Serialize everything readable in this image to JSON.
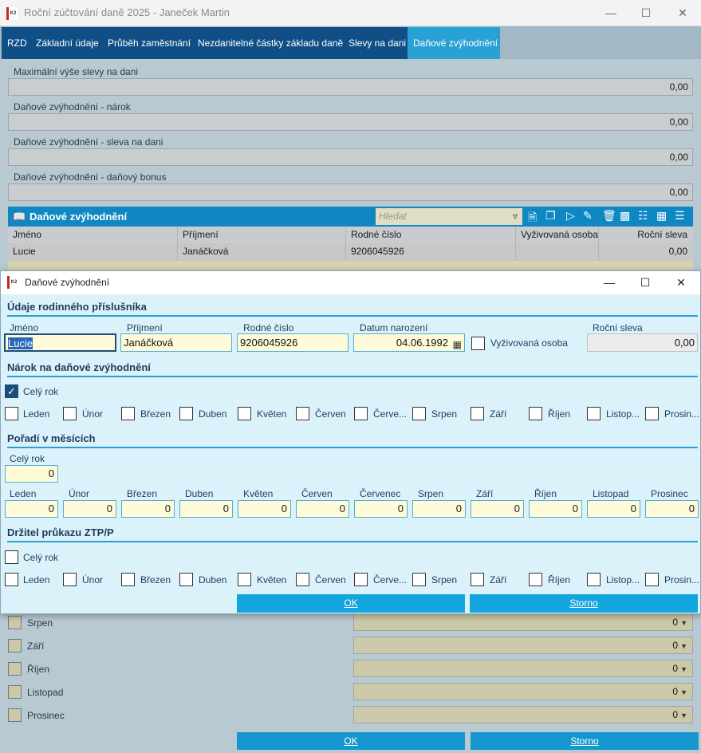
{
  "main_window": {
    "title": "Roční zúčtování daně 2025 - Janeček Martin",
    "logo_text": "K2",
    "tabs": [
      "RZD",
      "Základní údaje",
      "Průběh zaměstnání",
      "Nezdanitelné částky základu daně",
      "Slevy na dani",
      "Daňové zvýhodnění"
    ],
    "active_tab": "Daňové zvýhodnění",
    "fields": [
      {
        "label": "Maximální výše slevy na dani",
        "value": "0,00"
      },
      {
        "label": "Daňové zvýhodnění - nárok",
        "value": "0,00"
      },
      {
        "label": "Daňové zvýhodnění - sleva na dani",
        "value": "0,00"
      },
      {
        "label": "Daňové zvýhodnění - daňový bonus",
        "value": "0,00"
      }
    ],
    "grid": {
      "title": "Daňové zvýhodnění",
      "search_placeholder": "Hledat",
      "columns": [
        "Jméno",
        "Příjmení",
        "Rodné číslo",
        "Vyživovaná osoba",
        "Roční sleva"
      ],
      "rows": [
        {
          "jmeno": "Lucie",
          "prijmeni": "Janáčková",
          "rodne_cislo": "9206045926",
          "vyzivovana": "",
          "rocni_sleva": "0,00"
        }
      ]
    },
    "month_rows": [
      {
        "label": "Srpen",
        "value": "0"
      },
      {
        "label": "Září",
        "value": "0"
      },
      {
        "label": "Říjen",
        "value": "0"
      },
      {
        "label": "Listopad",
        "value": "0"
      },
      {
        "label": "Prosinec",
        "value": "0"
      }
    ],
    "ok_label": "OK",
    "cancel_label": "Storno"
  },
  "dialog": {
    "title": "Daňové zvýhodnění",
    "logo_text": "K2",
    "section_family": "Údaje rodinného příslušníka",
    "labels": {
      "jmeno": "Jméno",
      "prijmeni": "Příjmení",
      "rodne_cislo": "Rodné číslo",
      "datum_narozeni": "Datum narození",
      "vyzivovana": "Vyživovaná osoba",
      "rocni_sleva": "Roční sleva"
    },
    "values": {
      "jmeno": "Lucie",
      "prijmeni": "Janáčková",
      "rodne_cislo": "9206045926",
      "datum_narozeni": "04.06.1992",
      "vyzivovana_checked": false,
      "rocni_sleva": "0,00"
    },
    "section_narok": "Nárok na daňové zvýhodnění",
    "narok_cely_rok_label": "Celý rok",
    "narok_cely_rok_checked": true,
    "narok_months": [
      "Leden",
      "Únor",
      "Březen",
      "Duben",
      "Květen",
      "Červen",
      "Červe...",
      "Srpen",
      "Září",
      "Říjen",
      "Listop...",
      "Prosin..."
    ],
    "section_poradi": "Pořadí v měsících",
    "poradi_cely_rok_label": "Celý rok",
    "poradi_cely_rok_value": "0",
    "poradi_months": [
      {
        "label": "Leden",
        "value": "0"
      },
      {
        "label": "Únor",
        "value": "0"
      },
      {
        "label": "Březen",
        "value": "0"
      },
      {
        "label": "Duben",
        "value": "0"
      },
      {
        "label": "Květen",
        "value": "0"
      },
      {
        "label": "Červen",
        "value": "0"
      },
      {
        "label": "Červenec",
        "value": "0"
      },
      {
        "label": "Srpen",
        "value": "0"
      },
      {
        "label": "Září",
        "value": "0"
      },
      {
        "label": "Říjen",
        "value": "0"
      },
      {
        "label": "Listopad",
        "value": "0"
      },
      {
        "label": "Prosinec",
        "value": "0"
      }
    ],
    "section_ztp": "Držitel průkazu ZTP/P",
    "ztp_cely_rok_label": "Celý rok",
    "ztp_months": [
      "Leden",
      "Únor",
      "Březen",
      "Duben",
      "Květen",
      "Červen",
      "Červe...",
      "Srpen",
      "Září",
      "Říjen",
      "Listop...",
      "Prosin..."
    ],
    "ok_label": "OK",
    "cancel_label": "Storno"
  },
  "colors": {
    "tab_bg": "#0f4f86",
    "tab_active": "#2aa1d4",
    "grid_header": "#0e87c3",
    "button": "#13a5de",
    "dialog_bg": "#dcf2fb",
    "input_bg": "#fffbd8"
  }
}
